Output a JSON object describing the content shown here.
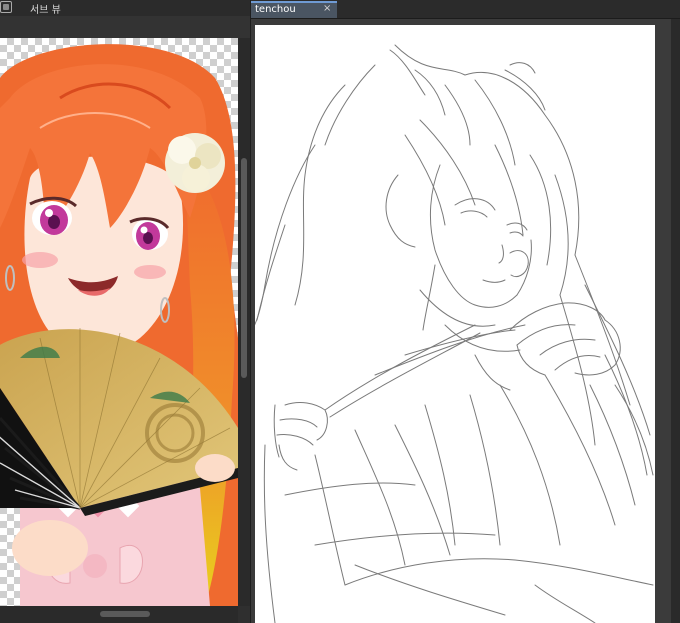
{
  "sub_view": {
    "tab_label": "서브 뷰",
    "tab_icon": "sub-view-icon"
  },
  "document": {
    "tab_label": "tenchou",
    "close_glyph": "×"
  },
  "colors": {
    "hair": "#f26a2e",
    "hair_dark": "#d94a1e",
    "skin": "#fde6d9",
    "eye": "#c2399b",
    "fan_paper": "#d4b15a",
    "fan_ribs": "#222222",
    "tab_accent": "#6f9bd4",
    "pencil": "#7a7a7a"
  }
}
